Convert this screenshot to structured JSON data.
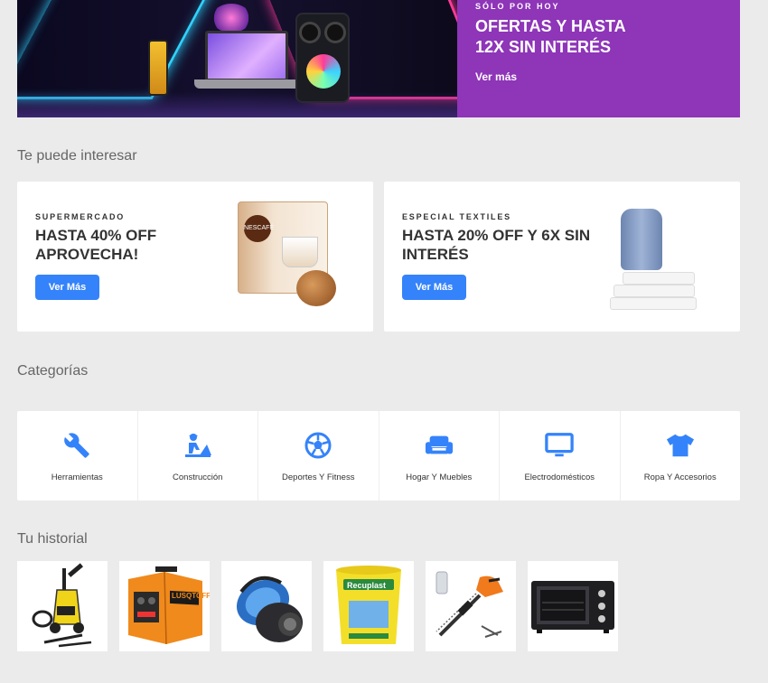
{
  "hero": {
    "kicker": "SÓLO POR HOY",
    "title": "OFERTAS Y HASTA 12X SIN INTERÉS",
    "link": "Ver más",
    "accent": "#8e35b8"
  },
  "interest": {
    "title": "Te puede interesar",
    "cards": [
      {
        "kicker": "SUPERMERCADO",
        "title": "HASTA 40% OFF APROVECHA!",
        "button": "Ver Más"
      },
      {
        "kicker": "ESPECIAL TEXTILES",
        "title": "HASTA 20% OFF Y 6X SIN INTERÉS",
        "button": "Ver Más"
      }
    ],
    "button_color": "#3483fa"
  },
  "categories": {
    "title": "Categorías",
    "items": [
      {
        "label": "Herramientas",
        "icon": "wrench-icon"
      },
      {
        "label": "Construcción",
        "icon": "construction-worker-icon"
      },
      {
        "label": "Deportes Y Fitness",
        "icon": "soccer-ball-icon"
      },
      {
        "label": "Hogar Y Muebles",
        "icon": "sofa-icon"
      },
      {
        "label": "Electrodomésticos",
        "icon": "monitor-icon"
      },
      {
        "label": "Ropa Y Accesorios",
        "icon": "tshirt-icon"
      }
    ],
    "icon_color": "#3483fa"
  },
  "history": {
    "title": "Tu historial",
    "items": [
      {
        "icon": "pressure-washer-icon"
      },
      {
        "icon": "welding-machine-icon",
        "brand": "LUSQTOFF"
      },
      {
        "icon": "vacuum-cleaner-icon"
      },
      {
        "icon": "paint-bucket-icon",
        "brand": "Recuplast"
      },
      {
        "icon": "hedge-trimmer-icon"
      },
      {
        "icon": "electric-oven-icon"
      }
    ]
  }
}
